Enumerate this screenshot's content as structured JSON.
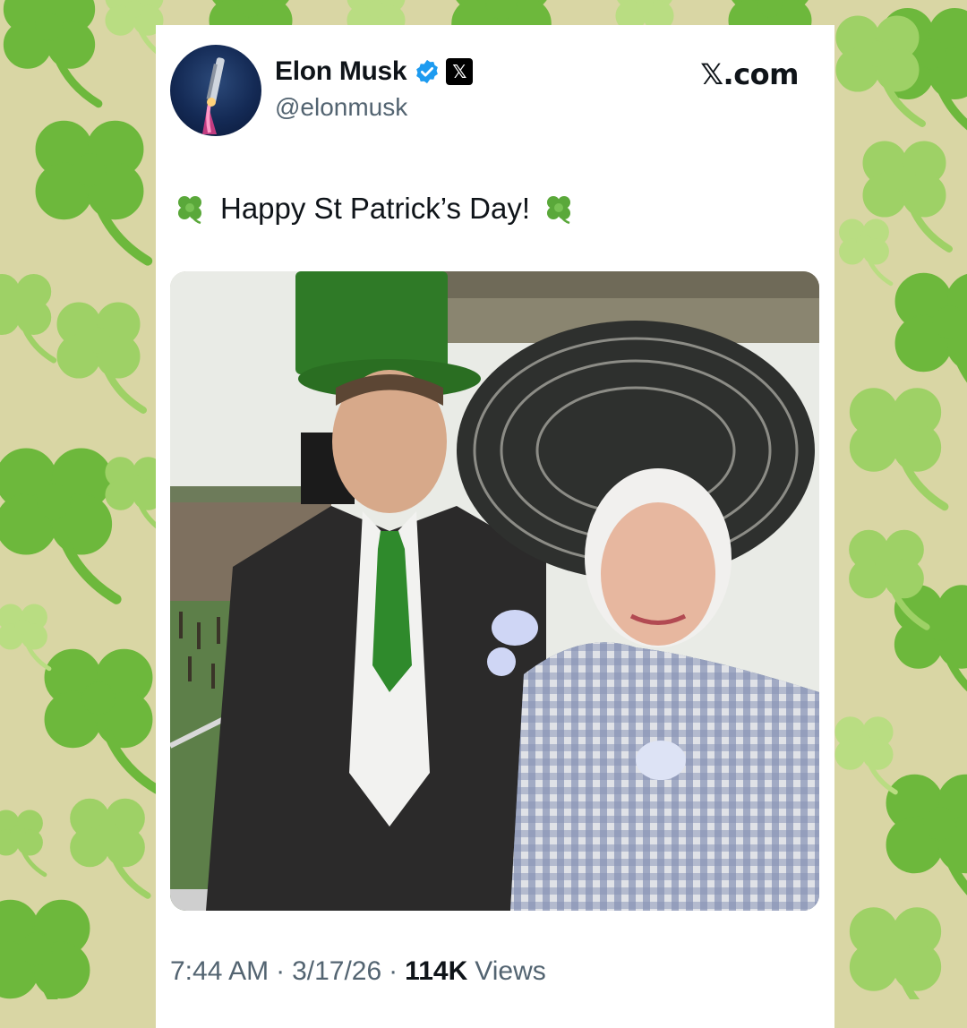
{
  "background": {
    "color": "#d9d6a4",
    "pattern_icon": "shamrock-icon",
    "shamrock_colors": [
      "#6ab83c",
      "#8fcc5a",
      "#b7dc7c"
    ]
  },
  "post": {
    "author": {
      "name": "Elon Musk",
      "handle": "@elonmusk",
      "avatar_icon": "rocket-avatar",
      "verified_icon": "verified-badge-icon",
      "affiliation_icon": "x-logo-icon",
      "verified_color": "#1d9bf0"
    },
    "source_label": "𝕏.com",
    "text": "Happy St Patrick’s Day!",
    "text_emoji": "shamrock-emoji",
    "image_description_icon": "photo",
    "timestamp_time": "7:44 AM",
    "timestamp_date": "3/17/26",
    "views_count": "114K",
    "views_label": "Views",
    "separator": "·"
  }
}
